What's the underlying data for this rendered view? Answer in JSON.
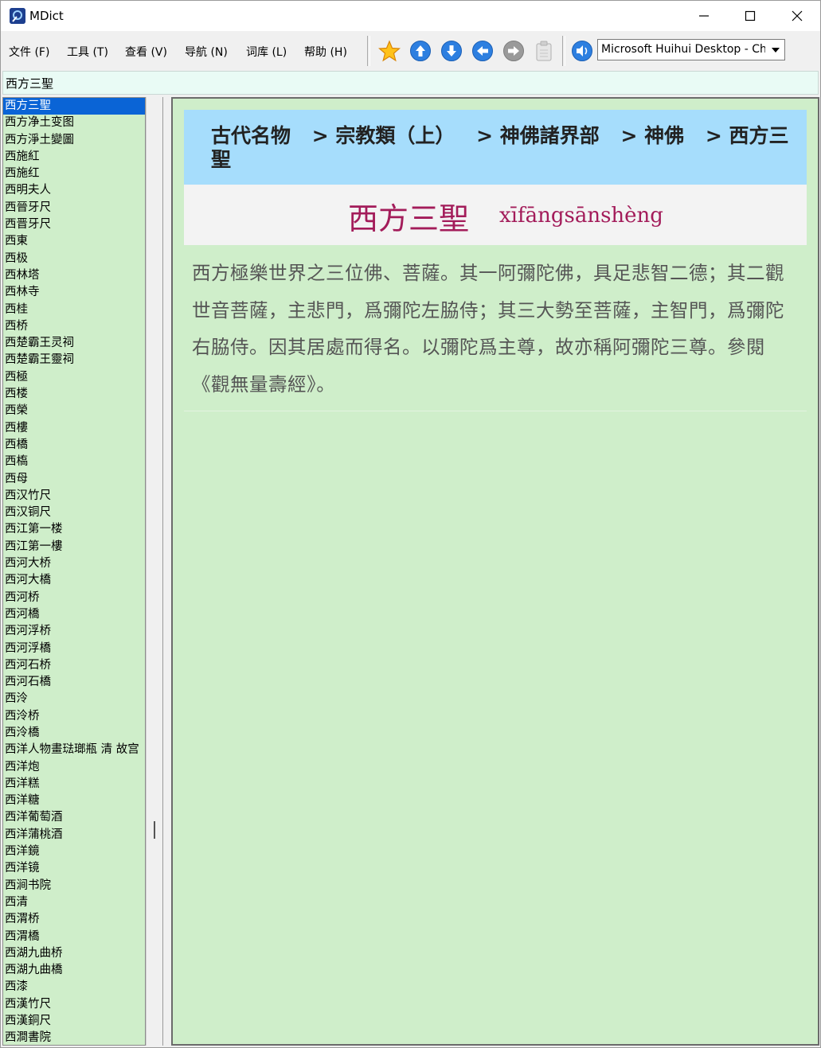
{
  "window": {
    "title": "MDict"
  },
  "menu": [
    {
      "label": "文件 (F)"
    },
    {
      "label": "工具 (T)"
    },
    {
      "label": "查看 (V)"
    },
    {
      "label": "导航 (N)"
    },
    {
      "label": "词库 (L)"
    },
    {
      "label": "帮助 (H)"
    }
  ],
  "toolbar": {
    "icons": [
      "star-icon",
      "arrow-up-icon",
      "arrow-down-icon",
      "arrow-left-icon",
      "arrow-right-icon",
      "clipboard-icon",
      "speaker-icon"
    ],
    "dictionary_selected": "Microsoft Huihui Desktop - Chinese (Simplified)"
  },
  "search": {
    "value": "西方三聖"
  },
  "wordlist": {
    "items": [
      "西方三聖",
      "西方净土变图",
      "西方淨土變圖",
      "西施紅",
      "西施红",
      "西明夫人",
      "西晉牙尺",
      "西晋牙尺",
      "西東",
      "西极",
      "西林塔",
      "西林寺",
      "西桂",
      "西桥",
      "西楚霸王灵祠",
      "西楚霸王靈祠",
      "西極",
      "西楼",
      "西榮",
      "西樓",
      "西橋",
      "西槗",
      "西母",
      "西汉竹尺",
      "西汉铜尺",
      "西江第一楼",
      "西江第一樓",
      "西河大桥",
      "西河大橋",
      "西河桥",
      "西河橋",
      "西河浮桥",
      "西河浮橋",
      "西河石桥",
      "西河石橋",
      "西泠",
      "西泠桥",
      "西泠橋",
      "西洋人物畫琺瑯瓶 清 故宫",
      "西洋炮",
      "西洋糕",
      "西洋糖",
      "西洋葡萄酒",
      "西洋蒲桃酒",
      "西洋鏡",
      "西洋镜",
      "西涧书院",
      "西清",
      "西渭桥",
      "西渭橋",
      "西湖九曲桥",
      "西湖九曲橋",
      "西漆",
      "西漢竹尺",
      "西漢銅尺",
      "西澗書院"
    ],
    "selected_index": 0
  },
  "entry": {
    "breadcrumb": [
      "古代名物",
      "> 宗教類（上）",
      "> 神佛諸界部",
      "> 神佛",
      "> 西方三聖"
    ],
    "headword": "西方三聖",
    "pinyin": "xīfāngsānshèng",
    "definition": "西方極樂世界之三位佛、菩薩。其一阿彌陀佛，具足悲智二德；其二觀世音菩薩，主悲門，爲彌陀左脇侍；其三大勢至菩薩，主智門，爲彌陀右脇侍。因其居處而得名。以彌陀爲主尊，故亦稱阿彌陀三尊。參閱《觀無量壽經》。"
  },
  "colors": {
    "list_background": "#cfeeca",
    "selection": "#0a64d6",
    "breadcrumb_background": "#a6ddfc",
    "headword": "#a31c5a",
    "search_background": "#e9fbf5"
  }
}
